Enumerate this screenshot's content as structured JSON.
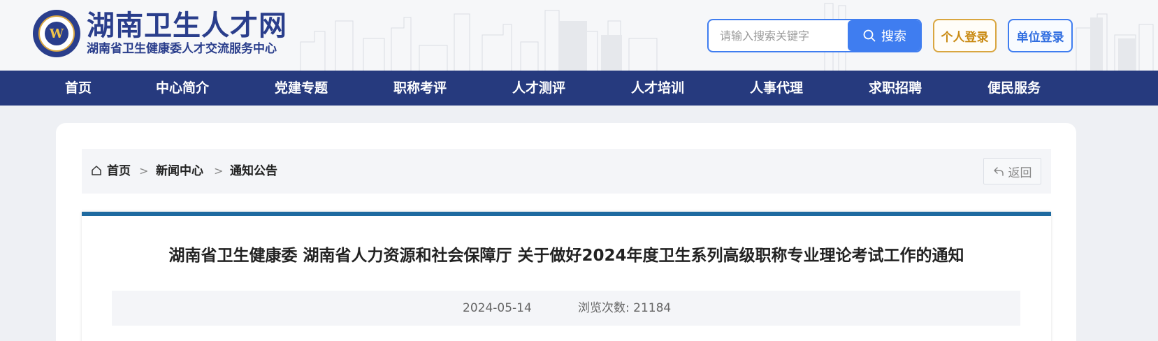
{
  "header": {
    "site_title": "湖南卫生人才网",
    "site_subtitle": "湖南省卫生健康委人才交流服务中心",
    "search_placeholder": "请输入搜索关键字",
    "search_label": "搜索",
    "login_personal": "个人登录",
    "login_unit": "单位登录"
  },
  "nav": {
    "items": [
      "首页",
      "中心简介",
      "党建专题",
      "职称考评",
      "人才测评",
      "人才培训",
      "人事代理",
      "求职招聘",
      "便民服务"
    ]
  },
  "breadcrumb": {
    "items": [
      "首页",
      "新闻中心",
      "通知公告"
    ],
    "separator": ">",
    "back_label": "返回"
  },
  "article": {
    "title": "湖南省卫生健康委 湖南省人力资源和社会保障厅 关于做好2024年度卫生系列高级职称专业理论考试工作的通知",
    "date": "2024-05-14",
    "views": "浏览次数: 21184"
  },
  "colors": {
    "brand": "#2a3e8c",
    "nav_bg": "#263a7e",
    "search_blue": "#3f7df0",
    "gold": "#d9a640",
    "article_accent": "#1e6aa0"
  }
}
